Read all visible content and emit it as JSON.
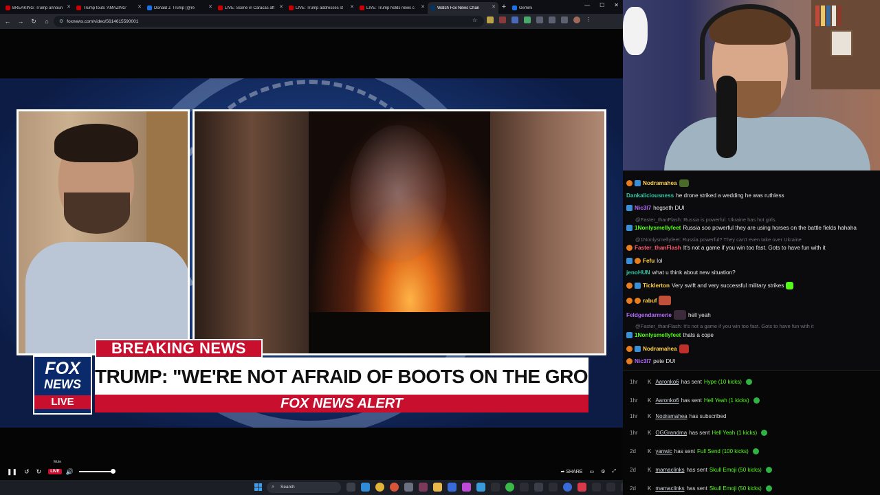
{
  "browser": {
    "tabs": [
      {
        "label": "BREAKING: Trump announ",
        "active": false,
        "icon": "youtube-icon"
      },
      {
        "label": "Trump touts 'AMAZING'",
        "active": false,
        "icon": "youtube-icon"
      },
      {
        "label": "Donald J. Trump (@re",
        "active": false,
        "icon": "truth-social-icon"
      },
      {
        "label": "LIVE: Scene in Caracas aft",
        "active": false,
        "icon": "youtube-icon"
      },
      {
        "label": "LIVE: Trump addresses st",
        "active": false,
        "icon": "youtube-icon"
      },
      {
        "label": "LIVE: Trump holds news c",
        "active": false,
        "icon": "youtube-icon"
      },
      {
        "label": "Watch Fox News Chan",
        "active": true,
        "icon": "fox-icon"
      },
      {
        "label": "Gemini",
        "active": false,
        "icon": "gemini-icon"
      }
    ],
    "url": "foxnews.com/video/5614615590001"
  },
  "video": {
    "breaking_tag": "BREAKING NEWS",
    "logo": {
      "line1": "FOX",
      "line2": "NEWS",
      "line3": "LIVE"
    },
    "headline": "TRUMP: \"WE'RE NOT AFRAID OF BOOTS ON THE GROUND\"",
    "alert": "FOX NEWS ALERT"
  },
  "player": {
    "live_label": "LIVE",
    "mute_tooltip": "Mute",
    "volume_level": 1.0,
    "share_label": "SHARE"
  },
  "taskbar": {
    "search_placeholder": "Search"
  },
  "chat": {
    "messages": [
      {
        "user": "Nodramahea",
        "text": "",
        "user_color": "#ffd24a",
        "reply": false
      },
      {
        "user": "Dankaliciousness",
        "text": "he drone striked a wedding he was ruthless",
        "user_color": "#2ec9a8",
        "reply": false
      },
      {
        "user": "Nic3l7",
        "text": "hegseth DUI",
        "user_color": "#b46aff",
        "reply": false
      },
      {
        "user": "",
        "text": "@Faster_thanFlash: Russia is powerful. Ukraine has hot girls.",
        "user_color": "",
        "reply": true
      },
      {
        "user": "1Nonlysmellyfeet",
        "text": "Russia soo powerful they are using horses on the battle fields hahaha",
        "user_color": "#53fc18",
        "reply": false
      },
      {
        "user": "",
        "text": "@1Nonlysmellyfeet: Russia powerful? They can't even take over Ukraine",
        "user_color": "",
        "reply": true
      },
      {
        "user": "Faster_thanFlash",
        "text": "It's not a game if you win too fast. Gots to have fun with it",
        "user_color": "#ff5a6e",
        "reply": false
      },
      {
        "user": "Fefu",
        "text": "lol",
        "user_color": "#ffd24a",
        "reply": false
      },
      {
        "user": "jenoHUN",
        "text": "what u think about new situation?",
        "user_color": "#2ec9a8",
        "reply": false
      },
      {
        "user": "Ticklerton",
        "text": "Very swift and very successful military strikes",
        "user_color": "#ffd24a",
        "reply": false
      },
      {
        "user": "rabuf",
        "text": "",
        "user_color": "#ffd24a",
        "reply": false
      },
      {
        "user": "Feldgendarmerie",
        "text": "hell yeah",
        "user_color": "#b46aff",
        "reply": false
      },
      {
        "user": "",
        "text": "@Faster_thanFlash: It's not a game if you win too fast. Gots to have fun with it",
        "user_color": "",
        "reply": true
      },
      {
        "user": "1Nonlysmellyfeet",
        "text": "thats a cope",
        "user_color": "#53fc18",
        "reply": false
      },
      {
        "user": "Nodramahea",
        "text": "",
        "user_color": "#ffd24a",
        "reply": false
      },
      {
        "user": "Nic3l7",
        "text": "pete DUI",
        "user_color": "#b46aff",
        "reply": false
      }
    ]
  },
  "events": [
    {
      "time": "1hr",
      "name": "Aaronko6",
      "action": "has sent",
      "item": "Hype (10 kicks)",
      "gift": true
    },
    {
      "time": "1hr",
      "name": "Aaronko6",
      "action": "has sent",
      "item": "Hell Yeah (1 kicks)",
      "gift": true
    },
    {
      "time": "1hr",
      "name": "Nodramahea",
      "action": "has subscribed",
      "item": "",
      "gift": false
    },
    {
      "time": "1hr",
      "name": "OGGrandma",
      "action": "has sent",
      "item": "Hell Yeah (1 kicks)",
      "gift": true
    },
    {
      "time": "2d",
      "name": "yanwic",
      "action": "has sent",
      "item": "Full Send (100 kicks)",
      "gift": true
    },
    {
      "time": "2d",
      "name": "mamaclinks",
      "action": "has sent",
      "item": "Skull Emoji (50 kicks)",
      "gift": true
    },
    {
      "time": "2d",
      "name": "mamaclinks",
      "action": "has sent",
      "item": "Skull Emoji (50 kicks)",
      "gift": true
    }
  ]
}
